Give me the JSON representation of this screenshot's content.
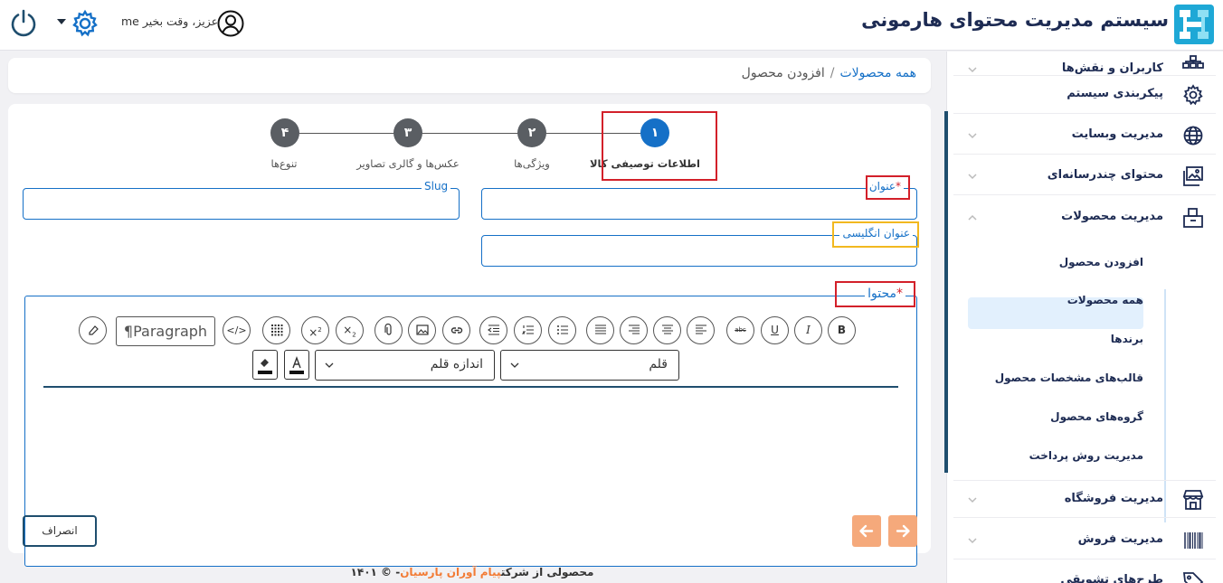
{
  "header": {
    "app_title": "سیستم مدیریت محتوای هارمونی",
    "greeting": "me عزیز، وقت بخیر"
  },
  "sidebar": {
    "items": [
      {
        "label": "کاربران و نقش‌ها",
        "icon": "sitemap-icon"
      },
      {
        "label": "پیکربندی سیستم",
        "icon": "gear-icon"
      },
      {
        "label": "مدیریت وبسایت",
        "icon": "globe-icon"
      },
      {
        "label": "محتوای چندرسانه‌ای",
        "icon": "images-icon"
      },
      {
        "label": "مدیریت محصولات",
        "icon": "product-box-icon"
      },
      {
        "label": "مدیریت فروشگاه",
        "icon": "store-icon"
      },
      {
        "label": "مدیریت فروش",
        "icon": "barcode-icon"
      },
      {
        "label": "طرح‌های تشویقی",
        "icon": "tag-icon"
      }
    ],
    "sub_items": [
      "افزودن محصول",
      "همه محصولات",
      "برندها",
      "قالب‌های مشخصات محصول",
      "گروه‌های محصول",
      "مدیریت روش پرداخت"
    ]
  },
  "breadcrumb": {
    "link": "همه محصولات",
    "separator": "/",
    "current": "افزودن محصول"
  },
  "stepper": {
    "steps": [
      {
        "num": "۱",
        "label": "اطلاعات توصیفی کالا",
        "active": true
      },
      {
        "num": "۲",
        "label": "ویژگی‌ها",
        "active": false
      },
      {
        "num": "۳",
        "label": "عکس‌ها و گالری تصاویر",
        "active": false
      },
      {
        "num": "۴",
        "label": "تنوع‌ها",
        "active": false
      }
    ]
  },
  "form": {
    "title_label": "عنوان",
    "required_mark": "*",
    "slug_label": "Slug",
    "english_title_label": "عنوان انگلیسی",
    "content_label": "محتوا"
  },
  "editor": {
    "paragraph_label": "Paragraph",
    "font_select": "قلم",
    "font_size_select": "اندازه قلم"
  },
  "actions": {
    "cancel": "انصراف"
  },
  "footer": {
    "prefix": "محصولی از شرکت",
    "company": "پیام آوران پارسیان",
    "suffix": "- © ۱۴۰۱"
  },
  "colors": {
    "primary": "#1570c7",
    "active_step": "#1570c7",
    "inactive_step": "#5a5e63",
    "highlight_red": "#d3202a",
    "highlight_yellow": "#f2b81f",
    "nav_orange": "#f5a97b",
    "footer_brand": "#f27b35"
  }
}
